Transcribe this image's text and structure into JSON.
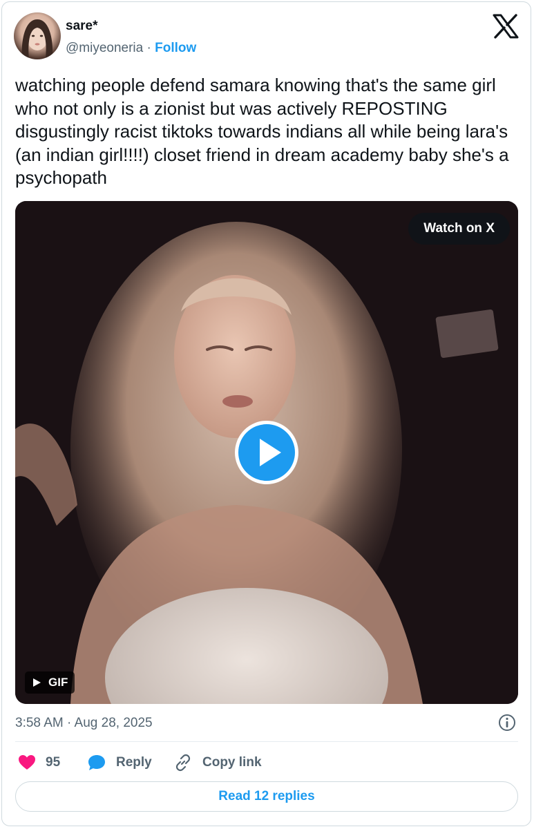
{
  "author": {
    "display_name": "sare*",
    "handle": "@miyeoneria",
    "separator": " · ",
    "follow_label": "Follow"
  },
  "icons": {
    "platform_logo": "x-logo-icon",
    "play": "play-icon",
    "gif_play": "play-small-icon",
    "info": "info-icon",
    "like": "heart-icon",
    "reply": "speech-bubble-icon",
    "copy_link": "link-icon"
  },
  "tweet": {
    "text": "watching people defend samara knowing that's the same girl who not only is a zionist but was actively REPOSTING disgustingly racist tiktoks towards indians all while being lara's (an indian girl!!!!) closet friend in dream academy baby she's a psychopath"
  },
  "media": {
    "watch_label": "Watch on X",
    "badge_label": "GIF"
  },
  "meta": {
    "timestamp": "3:58 AM · Aug 28, 2025"
  },
  "actions": {
    "like_count": "95",
    "reply_label": "Reply",
    "copy_link_label": "Copy link"
  },
  "footer": {
    "read_replies_label": "Read 12 replies"
  },
  "colors": {
    "accent": "#1d9bf0",
    "like": "#f91880",
    "text": "#0f1419",
    "muted": "#536471"
  }
}
